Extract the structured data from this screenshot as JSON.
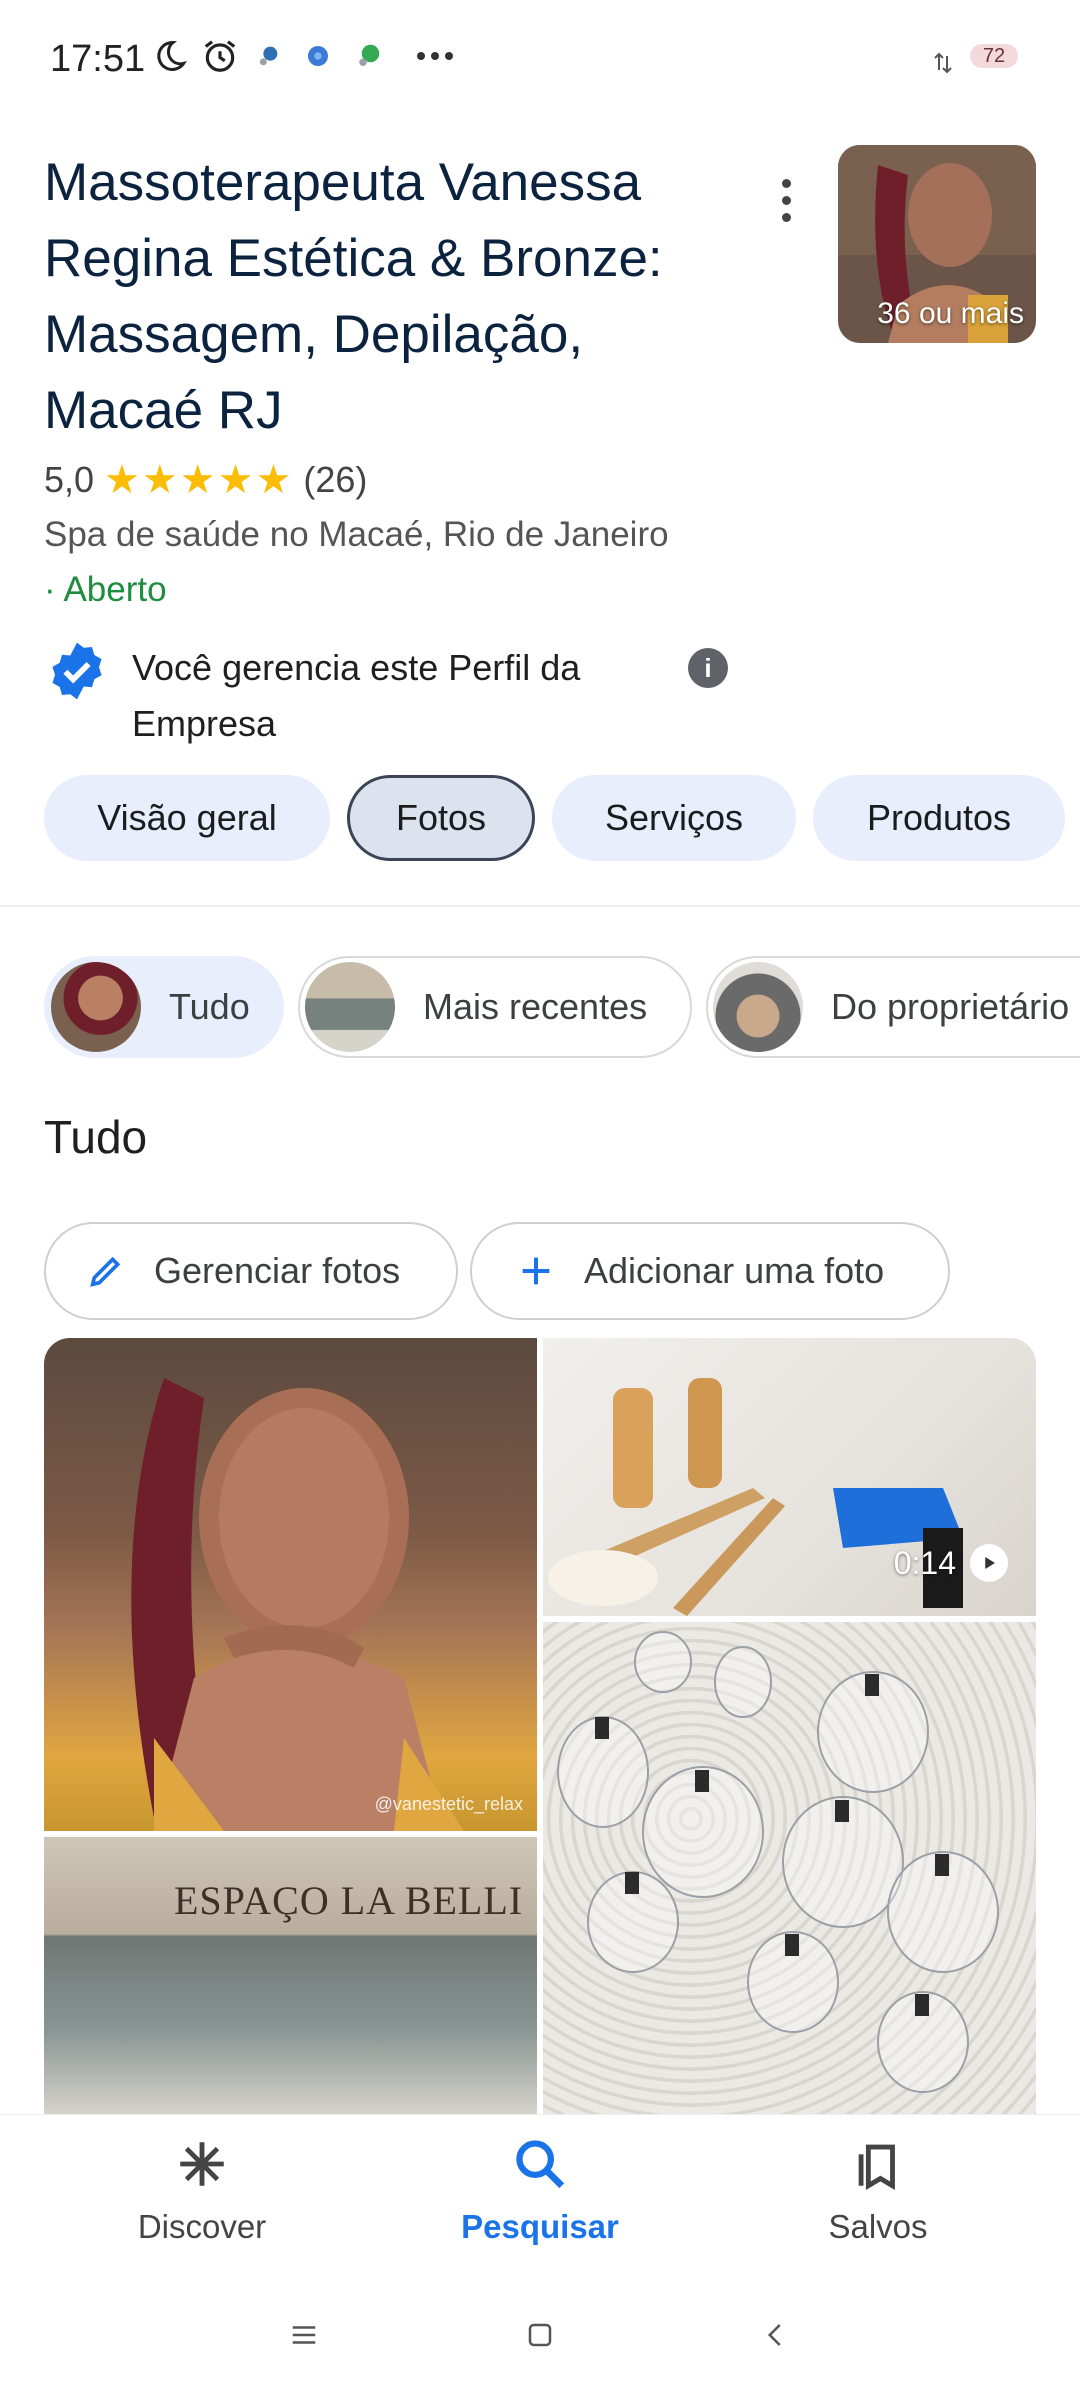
{
  "status_bar": {
    "time": "17:51",
    "battery": "72"
  },
  "header": {
    "title": "Massoterapeuta Vanessa Regina Estética & Bronze: Massagem, Depilação, Macaé RJ",
    "photos_caption": "36 ou mais",
    "rating": "5,0",
    "stars": "★★★★★",
    "review_count": "(26)",
    "category": "Spa de saúde no Macaé, Rio de Janeiro",
    "open_status": "· Aberto",
    "manage_text": "Você gerencia este Perfil da Empresa"
  },
  "tabs": [
    {
      "label": "Visão geral"
    },
    {
      "label": "Fotos"
    },
    {
      "label": "Serviços"
    },
    {
      "label": "Produtos"
    }
  ],
  "active_tab": "Fotos",
  "filter_chips": [
    {
      "label": "Tudo"
    },
    {
      "label": "Mais recentes"
    },
    {
      "label": "Do proprietário"
    }
  ],
  "section_title": "Tudo",
  "actions": {
    "manage_photos": "Gerenciar fotos",
    "add_photo": "Adicionar uma foto"
  },
  "photos": {
    "watermark": "@vanestetic_relax",
    "video_duration": "0:14",
    "storefront_sign": "ESPAÇO LA BELLI"
  },
  "bottom_nav": [
    {
      "label": "Discover",
      "icon": "asterisk-icon"
    },
    {
      "label": "Pesquisar",
      "icon": "search-icon"
    },
    {
      "label": "Salvos",
      "icon": "bookmarks-icon"
    }
  ],
  "colors": {
    "accent": "#1a73e8",
    "open": "#1e8e3e",
    "star": "#fbbc04",
    "chip_bg": "#e8eefb"
  }
}
